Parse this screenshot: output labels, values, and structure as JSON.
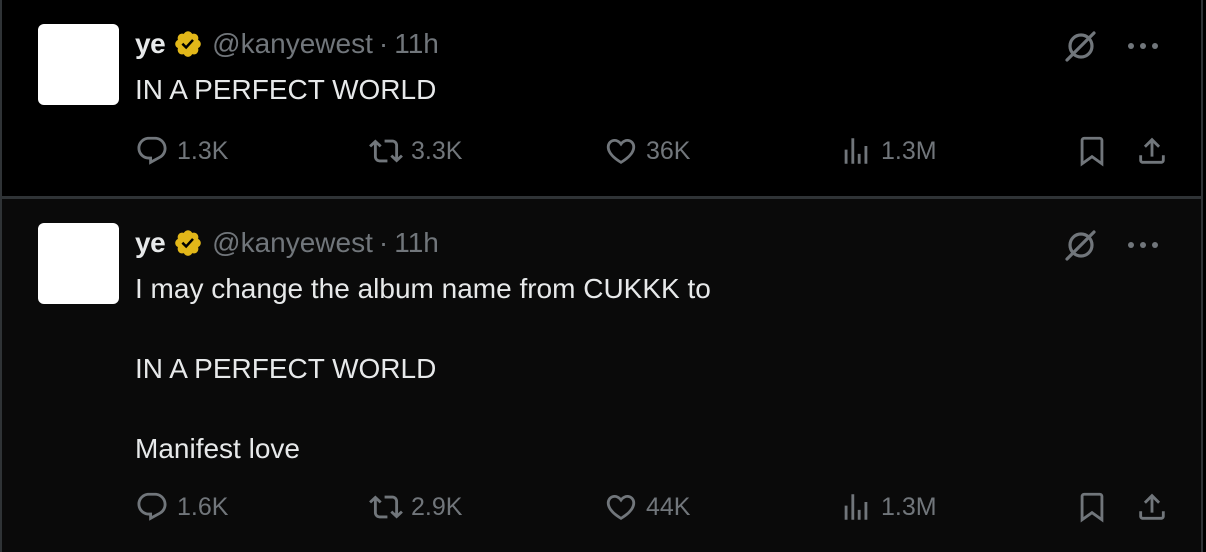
{
  "tweets": [
    {
      "name": "ye",
      "handle": "@kanyewest",
      "separator": "·",
      "time": "11h",
      "text": "IN A PERFECT WORLD",
      "stats": {
        "replies": "1.3K",
        "retweets": "3.3K",
        "likes": "36K",
        "views": "1.3M"
      }
    },
    {
      "name": "ye",
      "handle": "@kanyewest",
      "separator": "·",
      "time": "11h",
      "text": "I may change the album name from CUKKK to\n\nIN A PERFECT WORLD\n\nManifest love",
      "stats": {
        "replies": "1.6K",
        "retweets": "2.9K",
        "likes": "44K",
        "views": "1.3M"
      }
    }
  ],
  "icons": {
    "verified": "verified-badge-icon",
    "grok": "grok-icon",
    "more": "more-options-icon",
    "reply": "reply-icon",
    "retweet": "retweet-icon",
    "like": "heart-icon",
    "views": "views-icon",
    "bookmark": "bookmark-icon",
    "share": "share-icon"
  },
  "colors": {
    "background": "#000000",
    "primary_text": "#e7e9ea",
    "secondary_text": "#71767b",
    "border": "#2f3336",
    "verified_gold": "#e2b719"
  }
}
